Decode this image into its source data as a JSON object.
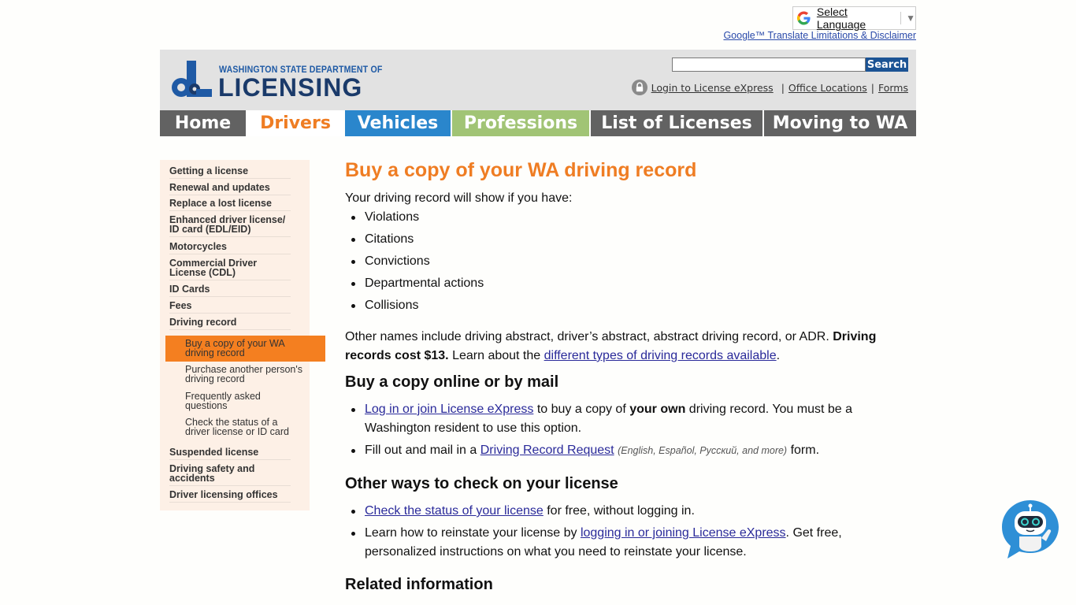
{
  "translate": {
    "label": "Select Language",
    "arrow": "▼",
    "disclaimer": "Google™ Translate Limitations & Disclaimer"
  },
  "header": {
    "logo_line1": "WASHINGTON STATE DEPARTMENT OF",
    "logo_line2": "LICENSING",
    "search_value": "",
    "search_button": "Search",
    "links": [
      "Login to License eXpress",
      "Office Locations",
      "Forms"
    ],
    "separator": "|"
  },
  "nav": {
    "tabs": [
      {
        "label": "Home",
        "bg": "#626262",
        "fg": "#ffffff"
      },
      {
        "label": "Drivers",
        "bg": "#ffffff",
        "fg": "#ef7d23"
      },
      {
        "label": "Vehicles",
        "bg": "#2a86cc",
        "fg": "#ffffff"
      },
      {
        "label": "Professions",
        "bg": "#a1c475",
        "fg": "#ffffff"
      },
      {
        "label": "List of Licenses",
        "bg": "#626262",
        "fg": "#ffffff"
      },
      {
        "label": "Moving to WA",
        "bg": "#626262",
        "fg": "#ffffff"
      }
    ]
  },
  "sidebar": {
    "items": [
      "Getting a license",
      "Renewal and updates",
      "Replace a lost license",
      "Enhanced driver license/ ID card (EDL/EID)",
      "Motorcycles",
      "Commercial Driver License (CDL)",
      "ID Cards",
      "Fees",
      "Driving record"
    ],
    "subitems": [
      "Buy a copy of your WA driving record",
      "Purchase another person's driving record",
      "Frequently asked questions",
      "Check the status of a driver license or ID card"
    ],
    "items_after": [
      "Suspended license",
      "Driving safety and accidents",
      "Driver licensing offices"
    ]
  },
  "main": {
    "title": "Buy a copy of your WA driving record",
    "intro": "Your driving record will show if you have:",
    "shows": [
      "Violations",
      "Citations",
      "Convictions",
      "Departmental actions",
      "Collisions"
    ],
    "other_names_1": "Other names include driving abstract, driver’s abstract, abstract driving record, or ADR.",
    "cost_bold": "Driving records cost $13.",
    "learn_prefix": "Learn about the",
    "learn_link": "different types of driving records available",
    "learn_suffix": ".",
    "sec1": "Buy a copy online or by mail",
    "b1_link": "Log in or join License eXpress",
    "b1_mid": "to buy a copy of",
    "b1_bold": "your own",
    "b1_rest": "driving record. You must be a Washington resident to use this option.",
    "b2_prefix": "Fill out and mail in a",
    "b2_link": "Driving Record Request",
    "b2_langs": "(English, Español, Русский, and more)",
    "b2_suffix": "form.",
    "sec2": "Other ways to check on your license",
    "c1_link": "Check the status of your license",
    "c1_rest": "for free, without logging in.",
    "c2_prefix": "Learn how to reinstate your license by",
    "c2_link": "logging in or joining License eXpress",
    "c2_rest": ". Get free, personalized instructions on what you need to reinstate your license.",
    "sec3": "Related information"
  },
  "colors": {
    "accent_orange": "#ef7d23",
    "sidebar_active": "#f47f20",
    "sidebar_bg": "#fdf0e6",
    "header_bg": "#e2e2e2",
    "search_button": "#1b5394",
    "link": "#2a2a9a"
  },
  "icons": {
    "google": "google-g-icon",
    "lock": "lock-icon",
    "chatbot": "chatbot-icon"
  }
}
